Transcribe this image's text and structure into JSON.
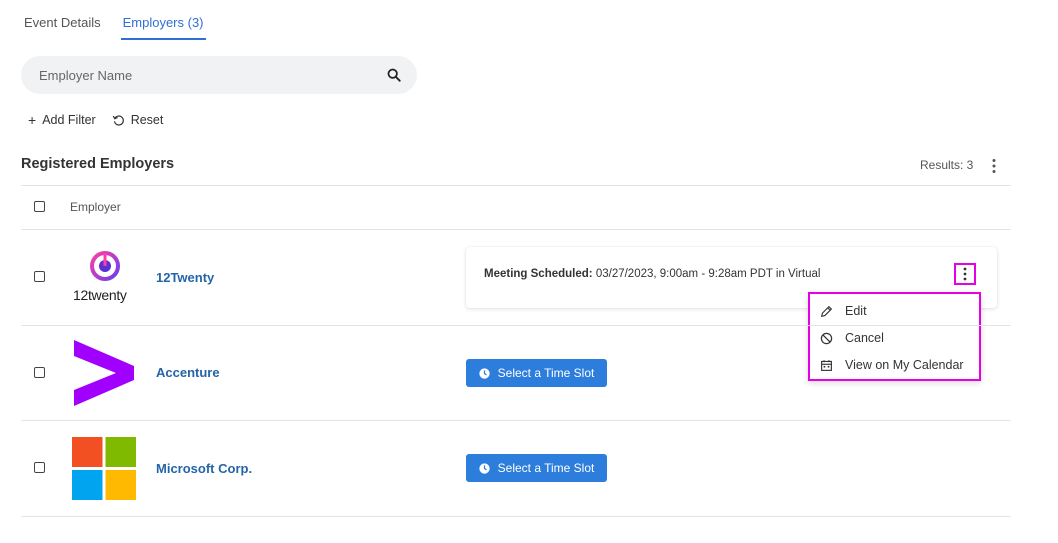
{
  "tabs": [
    {
      "label": "Event Details",
      "active": false
    },
    {
      "label": "Employers (3)",
      "active": true
    }
  ],
  "search": {
    "placeholder": "Employer Name",
    "icon": "search-icon"
  },
  "filters": {
    "add_filter": "Add Filter",
    "reset": "Reset"
  },
  "section": {
    "title": "Registered Employers",
    "results": "Results: 3"
  },
  "table": {
    "column_employer": "Employer"
  },
  "employers": [
    {
      "name": "12Twenty",
      "logo_text": "12twenty",
      "meeting": {
        "label": "Meeting Scheduled:",
        "details": "03/27/2023, 9:00am - 9:28am PDT in Virtual"
      }
    },
    {
      "name": "Accenture",
      "action": "Select a Time Slot"
    },
    {
      "name": "Microsoft Corp.",
      "action": "Select a Time Slot"
    }
  ],
  "menu": {
    "items": [
      {
        "label": "Edit",
        "icon": "pencil-icon"
      },
      {
        "label": "Cancel",
        "icon": "ban-icon"
      },
      {
        "label": "View on My Calendar",
        "icon": "calendar-icon"
      }
    ]
  },
  "colors": {
    "accent": "#2f6fd6",
    "link": "#2465a8",
    "button": "#2d7ddc",
    "highlight": "#e600e6",
    "accenture": "#a100ff"
  }
}
